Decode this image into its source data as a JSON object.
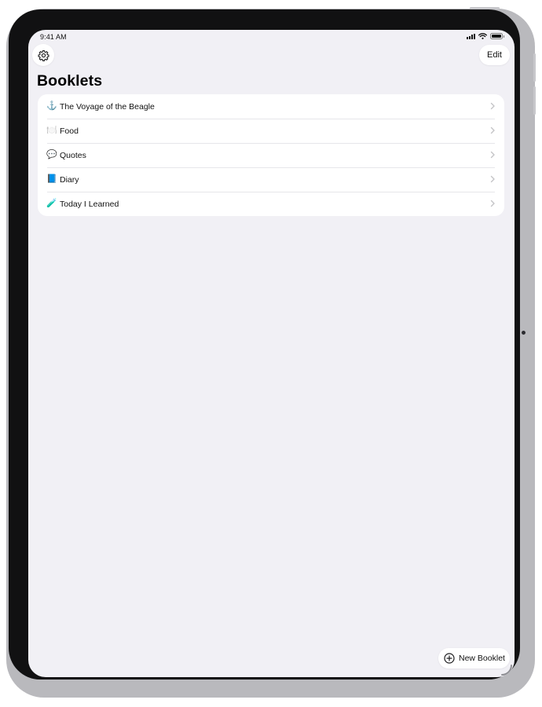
{
  "status_bar": {
    "time": "9:41 AM",
    "icons": [
      "cellular-signal-icon",
      "wifi-icon",
      "battery-icon"
    ]
  },
  "navigation": {
    "settings_icon": "gear-icon",
    "edit_label": "Edit"
  },
  "page": {
    "title": "Booklets"
  },
  "booklets": [
    {
      "emoji": "⚓",
      "label": "The Voyage of the Beagle"
    },
    {
      "emoji": "🍽️",
      "label": "Food"
    },
    {
      "emoji": "💬",
      "label": "Quotes"
    },
    {
      "emoji": "📘",
      "label": "Diary"
    },
    {
      "emoji": "🧪",
      "label": "Today I Learned"
    }
  ],
  "toolbar": {
    "new_booklet_label": "New Booklet",
    "new_booklet_icon": "plus-circle-icon"
  },
  "colors": {
    "background": "#f1f0f5",
    "card": "#ffffff",
    "chevron": "#c4c4c7",
    "text": "#111111"
  }
}
